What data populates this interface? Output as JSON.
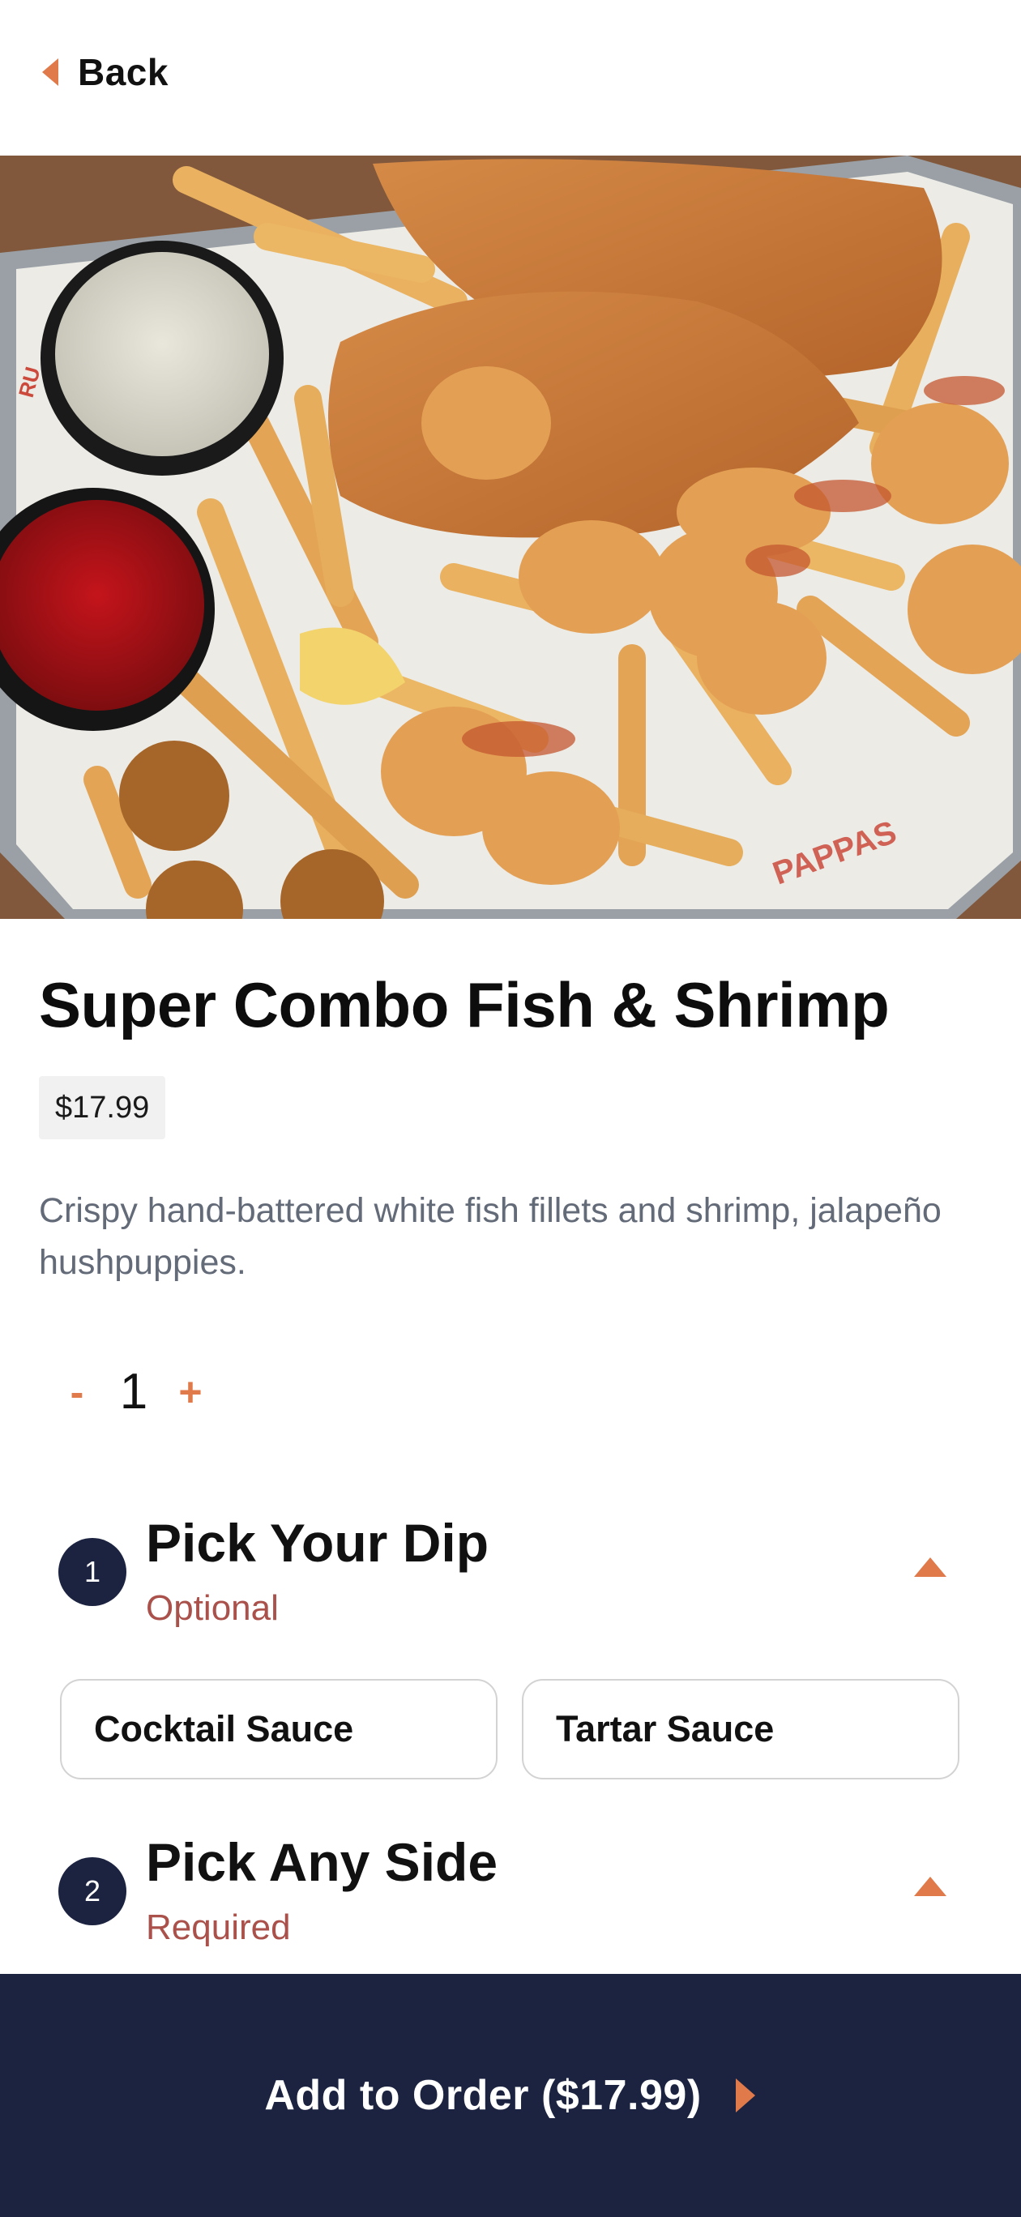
{
  "header": {
    "back_label": "Back"
  },
  "hero": {
    "image_description": "hero-food-photo"
  },
  "item": {
    "title": "Super Combo Fish & Shrimp",
    "price": "$17.99",
    "description": "Crispy hand-battered white fish fillets and shrimp, jalapeño hushpuppies."
  },
  "quantity": {
    "minus": "-",
    "value": "1",
    "plus": "+"
  },
  "sections": [
    {
      "number": "1",
      "title": "Pick Your Dip",
      "subtitle": "Optional",
      "options": [
        {
          "label": "Cocktail Sauce"
        },
        {
          "label": "Tartar Sauce"
        }
      ]
    },
    {
      "number": "2",
      "title": "Pick Any Side",
      "subtitle": "Required",
      "options": []
    }
  ],
  "footer": {
    "add_label": "Add to Order ($17.99)"
  },
  "colors": {
    "accent": "#e07a4a",
    "navy": "#1b2340",
    "subtitle_red": "#a9514a",
    "description_gray": "#636a78"
  }
}
